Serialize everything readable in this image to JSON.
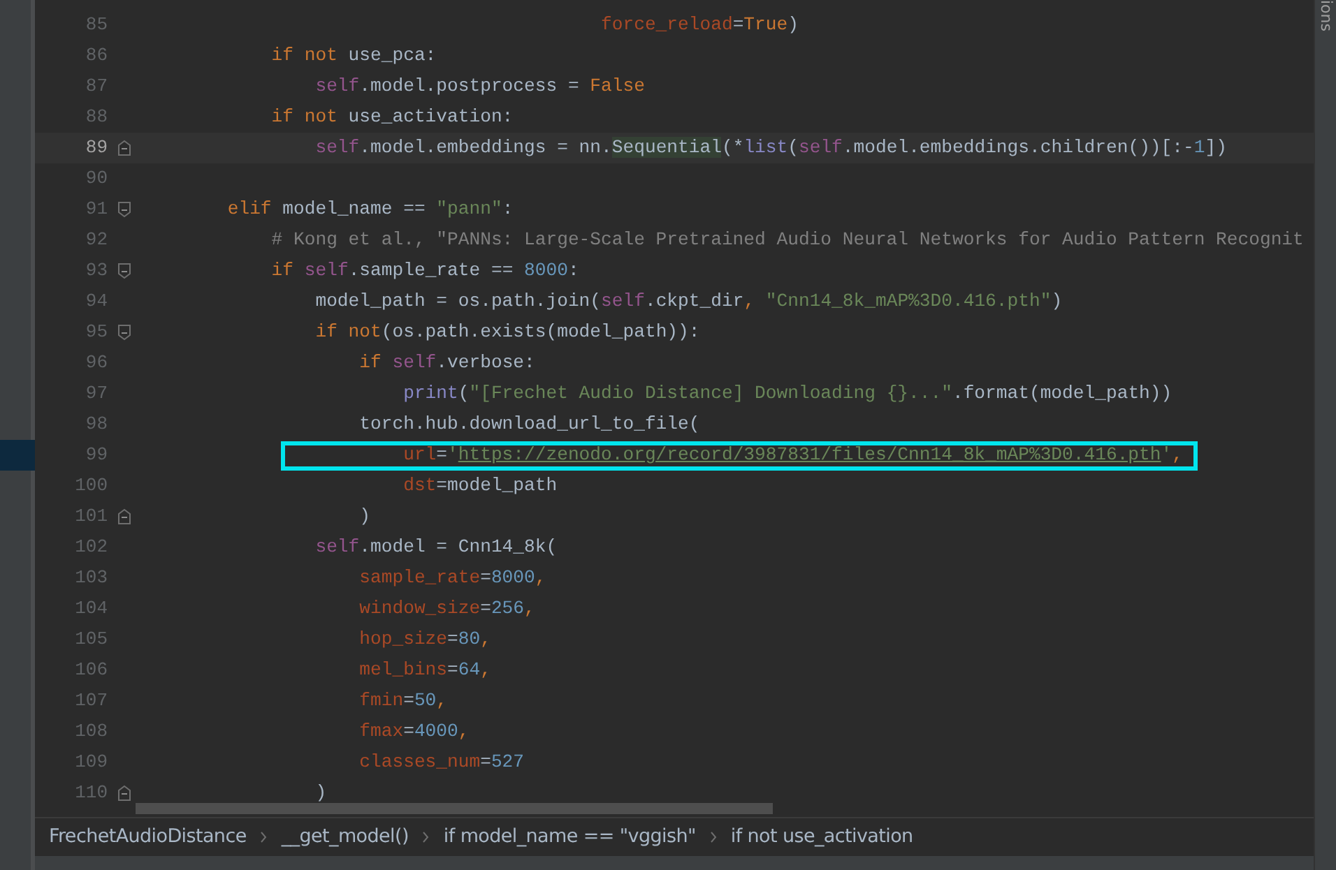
{
  "editor": {
    "lines": [
      {
        "number": "85",
        "tokens": [
          {
            "kind": "param",
            "text": "                                          force_reload"
          },
          {
            "kind": "plain",
            "text": "="
          },
          {
            "kind": "keyword",
            "text": "True"
          },
          {
            "kind": "plain",
            "text": ")"
          }
        ]
      },
      {
        "number": "86",
        "tokens": [
          {
            "kind": "keyword",
            "text": "            if not "
          },
          {
            "kind": "plain",
            "text": "use_pca:"
          }
        ]
      },
      {
        "number": "87",
        "tokens": [
          {
            "kind": "self",
            "text": "                self"
          },
          {
            "kind": "plain",
            "text": ".model.postprocess = "
          },
          {
            "kind": "keyword",
            "text": "False"
          }
        ]
      },
      {
        "number": "88",
        "tokens": [
          {
            "kind": "keyword",
            "text": "            if not "
          },
          {
            "kind": "plain",
            "text": "use_activation:"
          }
        ]
      },
      {
        "number": "89",
        "current": true,
        "fold_end": true,
        "tokens": [
          {
            "kind": "self",
            "text": "                self"
          },
          {
            "kind": "plain",
            "text": ".model.embeddings = nn."
          },
          {
            "kind": "match",
            "text": "Sequential"
          },
          {
            "kind": "plain",
            "text": "(*"
          },
          {
            "kind": "builtin",
            "text": "list"
          },
          {
            "kind": "plain",
            "text": "("
          },
          {
            "kind": "self",
            "text": "self"
          },
          {
            "kind": "plain",
            "text": ".model.embeddings.children())[:-"
          },
          {
            "kind": "number",
            "text": "1"
          },
          {
            "kind": "plain",
            "text": "])"
          }
        ]
      },
      {
        "number": "90"
      },
      {
        "number": "91",
        "fold_start": true,
        "tokens": [
          {
            "kind": "keyword",
            "text": "        elif "
          },
          {
            "kind": "plain",
            "text": "model_name == "
          },
          {
            "kind": "string",
            "text": "\"pann\""
          },
          {
            "kind": "plain",
            "text": ":"
          }
        ]
      },
      {
        "number": "92",
        "tokens": [
          {
            "kind": "comment",
            "text": "            # Kong et al., \"PANNs: Large-Scale Pretrained Audio Neural Networks for Audio Pattern Recognit"
          }
        ]
      },
      {
        "number": "93",
        "fold_start": true,
        "tokens": [
          {
            "kind": "keyword",
            "text": "            if "
          },
          {
            "kind": "self",
            "text": "self"
          },
          {
            "kind": "plain",
            "text": ".sample_rate == "
          },
          {
            "kind": "number",
            "text": "8000"
          },
          {
            "kind": "plain",
            "text": ":"
          }
        ]
      },
      {
        "number": "94",
        "tokens": [
          {
            "kind": "plain",
            "text": "                model_path = os.path.join("
          },
          {
            "kind": "self",
            "text": "self"
          },
          {
            "kind": "plain",
            "text": ".ckpt_dir"
          },
          {
            "kind": "keyword",
            "text": ", "
          },
          {
            "kind": "string",
            "text": "\"Cnn14_8k_mAP%3D0.416.pth\""
          },
          {
            "kind": "plain",
            "text": ")"
          }
        ]
      },
      {
        "number": "95",
        "fold_start": true,
        "tokens": [
          {
            "kind": "keyword",
            "text": "                if not"
          },
          {
            "kind": "plain",
            "text": "(os.path.exists(model_path)):"
          }
        ]
      },
      {
        "number": "96",
        "tokens": [
          {
            "kind": "keyword",
            "text": "                    if "
          },
          {
            "kind": "self",
            "text": "self"
          },
          {
            "kind": "plain",
            "text": ".verbose:"
          }
        ]
      },
      {
        "number": "97",
        "tokens": [
          {
            "kind": "builtin",
            "text": "                        print"
          },
          {
            "kind": "plain",
            "text": "("
          },
          {
            "kind": "string",
            "text": "\"[Frechet Audio Distance] Downloading {}...\""
          },
          {
            "kind": "plain",
            "text": ".format(model_path))"
          }
        ]
      },
      {
        "number": "98",
        "tokens": [
          {
            "kind": "plain",
            "text": "                    torch.hub.download_url_to_file("
          }
        ]
      },
      {
        "number": "99",
        "marked": true,
        "boxed": true,
        "tokens": [
          {
            "kind": "param",
            "text": "                        url"
          },
          {
            "kind": "plain",
            "text": "="
          },
          {
            "kind": "string",
            "text": "'"
          },
          {
            "kind": "url",
            "text": "https://zenodo.org/record/3987831/files/Cnn14_8k_mAP%3D0.416.pth"
          },
          {
            "kind": "string",
            "text": "'"
          },
          {
            "kind": "keyword",
            "text": ","
          }
        ]
      },
      {
        "number": "100",
        "tokens": [
          {
            "kind": "param",
            "text": "                        dst"
          },
          {
            "kind": "plain",
            "text": "=model_path"
          }
        ]
      },
      {
        "number": "101",
        "fold_end": true,
        "tokens": [
          {
            "kind": "plain",
            "text": "                    )"
          }
        ]
      },
      {
        "number": "102",
        "tokens": [
          {
            "kind": "self",
            "text": "                self"
          },
          {
            "kind": "plain",
            "text": ".model = Cnn14_8k("
          }
        ]
      },
      {
        "number": "103",
        "tokens": [
          {
            "kind": "param",
            "text": "                    sample_rate"
          },
          {
            "kind": "plain",
            "text": "="
          },
          {
            "kind": "number",
            "text": "8000"
          },
          {
            "kind": "keyword",
            "text": ","
          }
        ]
      },
      {
        "number": "104",
        "tokens": [
          {
            "kind": "param",
            "text": "                    window_size"
          },
          {
            "kind": "plain",
            "text": "="
          },
          {
            "kind": "number",
            "text": "256"
          },
          {
            "kind": "keyword",
            "text": ","
          }
        ]
      },
      {
        "number": "105",
        "tokens": [
          {
            "kind": "param",
            "text": "                    hop_size"
          },
          {
            "kind": "plain",
            "text": "="
          },
          {
            "kind": "number",
            "text": "80"
          },
          {
            "kind": "keyword",
            "text": ","
          }
        ]
      },
      {
        "number": "106",
        "tokens": [
          {
            "kind": "param",
            "text": "                    mel_bins"
          },
          {
            "kind": "plain",
            "text": "="
          },
          {
            "kind": "number",
            "text": "64"
          },
          {
            "kind": "keyword",
            "text": ","
          }
        ]
      },
      {
        "number": "107",
        "tokens": [
          {
            "kind": "param",
            "text": "                    fmin"
          },
          {
            "kind": "plain",
            "text": "="
          },
          {
            "kind": "number",
            "text": "50"
          },
          {
            "kind": "keyword",
            "text": ","
          }
        ]
      },
      {
        "number": "108",
        "tokens": [
          {
            "kind": "param",
            "text": "                    fmax"
          },
          {
            "kind": "plain",
            "text": "="
          },
          {
            "kind": "number",
            "text": "4000"
          },
          {
            "kind": "keyword",
            "text": ","
          }
        ]
      },
      {
        "number": "109",
        "tokens": [
          {
            "kind": "param",
            "text": "                    classes_num"
          },
          {
            "kind": "plain",
            "text": "="
          },
          {
            "kind": "number",
            "text": "527"
          }
        ]
      },
      {
        "number": "110",
        "fold_end": true,
        "tokens": [
          {
            "kind": "plain",
            "text": "                )"
          }
        ]
      }
    ]
  },
  "breadcrumbs": [
    "FrechetAudioDistance",
    "__get_model()",
    "if model_name == \"vggish\"",
    "if not use_activation"
  ],
  "side_panel": {
    "label": "ions"
  }
}
